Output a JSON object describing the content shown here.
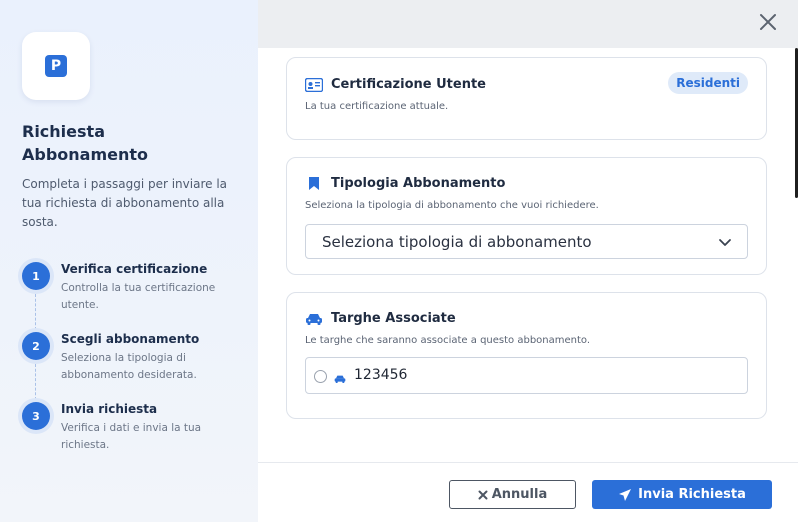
{
  "sidebar": {
    "logo_letter": "P",
    "title": "Richiesta Abbonamento",
    "description": "Completa i passaggi per inviare la tua richiesta di abbonamento alla sosta.",
    "steps": [
      {
        "number": "1",
        "title": "Verifica certificazione",
        "description": "Controlla la tua certificazione utente."
      },
      {
        "number": "2",
        "title": "Scegli abbonamento",
        "description": "Seleziona la tipologia di abbonamento desiderata."
      },
      {
        "number": "3",
        "title": "Invia richiesta",
        "description": "Verifica i dati e invia la tua richiesta."
      }
    ]
  },
  "dialog": {
    "close_icon": "close-icon",
    "certification": {
      "title": "Certificazione Utente",
      "subtitle": "La tua certificazione attuale.",
      "badge": "Residenti",
      "icon": "id-card-icon"
    },
    "subscription_type": {
      "title": "Tipologia Abbonamento",
      "subtitle": "Seleziona la tipologia di abbonamento che vuoi richiedere.",
      "select_value": "Seleziona tipologia di abbonamento",
      "icon": "bookmark-icon"
    },
    "plates": {
      "title": "Targhe Associate",
      "subtitle": "Le targhe che saranno associate a questo abbonamento.",
      "items": [
        {
          "plate": "123456",
          "selected": false
        }
      ],
      "icon": "car-icon"
    },
    "footer": {
      "cancel_label": "Annulla",
      "submit_label": "Invia Richiesta"
    }
  },
  "colors": {
    "accent": "#2b6fd8",
    "badge_bg": "#dfeaf9",
    "title_text": "#1d2e4c"
  }
}
